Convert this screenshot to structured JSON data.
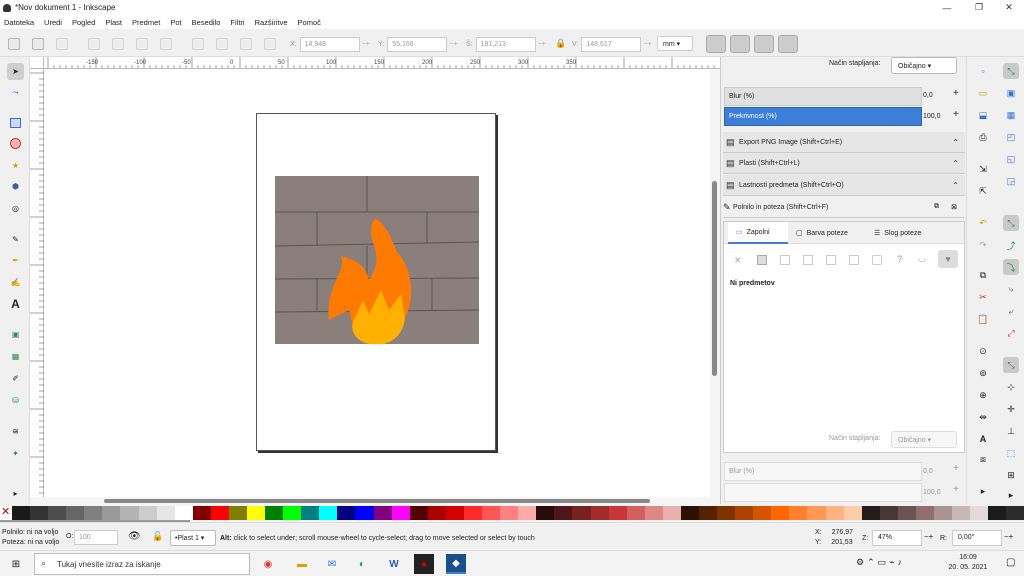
{
  "window": {
    "title": "*Nov dokument 1 - Inkscape",
    "minimize": "—",
    "maximize": "❐",
    "close": "✕"
  },
  "menu": [
    "Datoteka",
    "Uredi",
    "Pogled",
    "Plast",
    "Predmet",
    "Pot",
    "Besedilo",
    "Filtri",
    "Razširitve",
    "Pomoč"
  ],
  "toolbar": {
    "x_label": "X:",
    "x_value": "14,948",
    "y_label": "Y:",
    "y_value": "55,168",
    "w_label": "Š:",
    "w_value": "181,213",
    "h_label": "V:",
    "h_value": "148,617",
    "unit": "mm"
  },
  "ruler_ticks": [
    "-150",
    "-100",
    "-50",
    "0",
    "50",
    "100",
    "150",
    "200",
    "250",
    "300",
    "350"
  ],
  "dock": {
    "blend_mode_label": "Način stapljanja:",
    "blend_mode_value": "Običajno",
    "blur_label": "Blur (%)",
    "blur_value": "0,0",
    "opacity_label": "Prekrivnost (%)",
    "opacity_value": "100,0",
    "panel_export": "Export PNG Image (Shift+Ctrl+E)",
    "panel_layers": "Plasti  (Shift+Ctrl+L)",
    "panel_object_props": "Lastnosti predmeta  (Shift+Ctrl+O)",
    "panel_fill_stroke": "Polnilo in poteza  (Shift+Ctrl+F)",
    "tab_fill": "Zapolni",
    "tab_stroke_paint": "Barva poteze",
    "tab_stroke_style": "Slog poteze",
    "no_objects": "Ni predmetov",
    "lower_blend_label": "Način stapljanja:",
    "lower_blend_value": "Običajno",
    "lower_blur_label": "Blur (%)",
    "lower_blur_value": "0,0",
    "lower_opacity_value": "100,0"
  },
  "status": {
    "fill_label": "Polnilo:",
    "fill_value": "ni na voljo",
    "stroke_label": "Poteza:",
    "stroke_value": "ni na voljo",
    "o_label": "O:",
    "o_value": "100",
    "layer": "•Plast 1",
    "message_bold": "Alt:",
    "message": " click to select under; scroll mouse-wheel to cycle-select; drag to move selected or select by touch",
    "x_label": "X:",
    "x_value": "276,97",
    "y_label": "Y:",
    "y_value": "201,53",
    "zoom_label": "Z:",
    "zoom_value": "47%",
    "rot_label": "R:",
    "rot_value": "0,00°"
  },
  "taskbar": {
    "search_placeholder": "Tukaj vnesite izraz za iskanje",
    "time": "16:09",
    "date": "20. 05. 2021"
  },
  "colors": {
    "accent": "#3d7ed8",
    "brick": "#8a7f7a",
    "flame_outer": "#ff7a00",
    "flame_inner": "#ffb000"
  },
  "palette": [
    "#1a1a1a",
    "#333333",
    "#4d4d4d",
    "#666666",
    "#808080",
    "#999999",
    "#b3b3b3",
    "#cccccc",
    "#e6e6e6",
    "#ffffff",
    "#800000",
    "#ff0000",
    "#808000",
    "#ffff00",
    "#008000",
    "#00ff00",
    "#008080",
    "#00ffff",
    "#000080",
    "#0000ff",
    "#800080",
    "#ff00ff",
    "#550000",
    "#aa0000",
    "#d40000",
    "#ff2a2a",
    "#ff5555",
    "#ff8080",
    "#ffaaaa",
    "#280b0b",
    "#501616",
    "#782121",
    "#a02c2c",
    "#c83737",
    "#d35f5f",
    "#de8787",
    "#e9afaf",
    "#2b1100",
    "#552200",
    "#803300",
    "#aa4400",
    "#d45500",
    "#ff6600",
    "#ff7f2a",
    "#ff9955",
    "#ffb380",
    "#ffccaa",
    "#241c1c",
    "#483737",
    "#6c5353",
    "#916f6f",
    "#ac9393",
    "#c8b7b7",
    "#e3dbdb",
    "#1c1c1c",
    "#2c2c2c"
  ]
}
